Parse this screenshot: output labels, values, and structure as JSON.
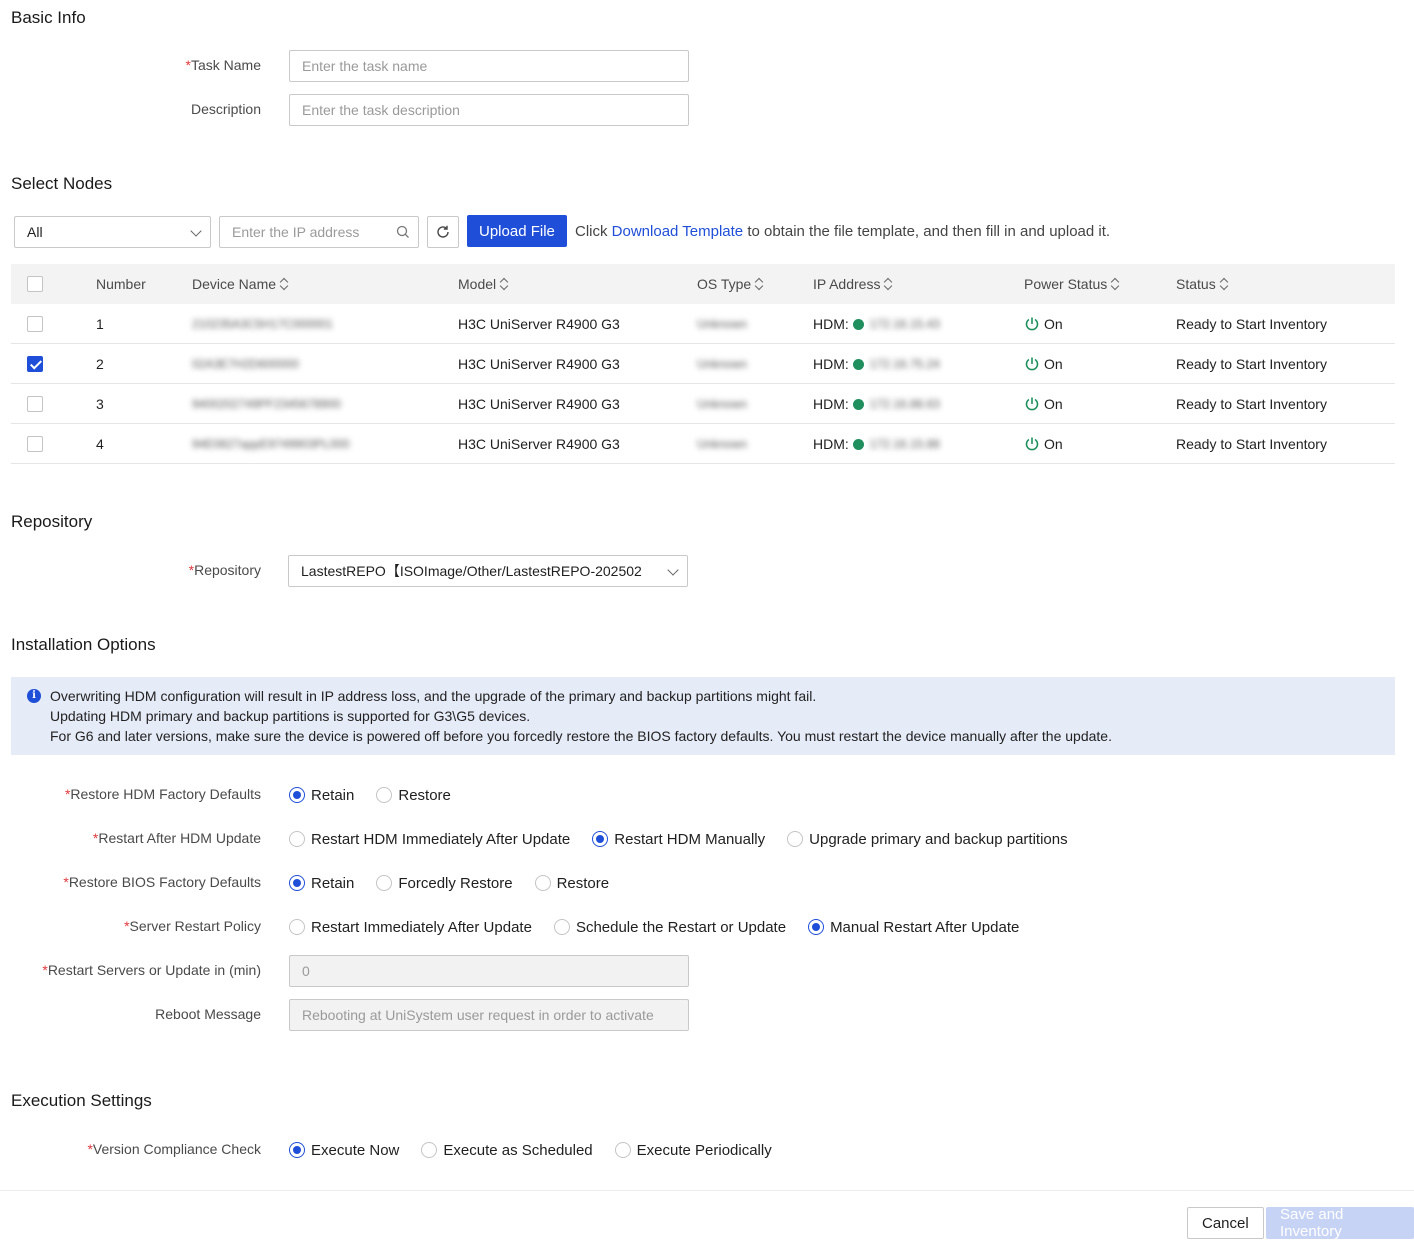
{
  "basic_info": {
    "title": "Basic Info",
    "task_name_label": "Task Name",
    "task_name_placeholder": "Enter the task name",
    "description_label": "Description",
    "description_placeholder": "Enter the task description"
  },
  "select_nodes": {
    "title": "Select Nodes",
    "filter_value": "All",
    "ip_placeholder": "Enter the IP address",
    "upload_label": "Upload File",
    "hint_prefix": "Click ",
    "hint_link": "Download Template",
    "hint_suffix": " to obtain the file template, and then fill in and upload it.",
    "columns": [
      "Number",
      "Device Name",
      "Model",
      "OS Type",
      "IP Address",
      "Power Status",
      "Status"
    ],
    "rows": [
      {
        "checked": false,
        "number": "1",
        "device": "210235A3C5H17C000001",
        "model": "H3C UniServer R4900 G3",
        "os": "Unknown",
        "ip_prefix": "HDM:",
        "ip": "172.16.15.43",
        "power": "On",
        "status": "Ready to Start Inventory"
      },
      {
        "checked": true,
        "number": "2",
        "device": "02A3E7H2D600000",
        "model": "H3C UniServer R4900 G3",
        "os": "Unknown",
        "ip_prefix": "HDM:",
        "ip": "172.16.75.24",
        "power": "On",
        "status": "Ready to Start Inventory"
      },
      {
        "checked": false,
        "number": "3",
        "device": "9400202749PF2345678900",
        "model": "H3C UniServer R4900 G3",
        "os": "Unknown",
        "ip_prefix": "HDM:",
        "ip": "172.16.88.63",
        "power": "On",
        "status": "Ready to Start Inventory"
      },
      {
        "checked": false,
        "number": "4",
        "device": "94E0827appE9749903PL000",
        "model": "H3C UniServer R4900 G3",
        "os": "Unknown",
        "ip_prefix": "HDM:",
        "ip": "172.16.15.88",
        "power": "On",
        "status": "Ready to Start Inventory"
      }
    ]
  },
  "repository": {
    "title": "Repository",
    "label": "Repository",
    "value": "LastestREPO【ISOImage/Other/LastestREPO-202502"
  },
  "installation": {
    "title": "Installation Options",
    "info_lines": [
      "Overwriting HDM configuration will result in IP address loss, and the upgrade of the primary and backup partitions might fail.",
      "Updating HDM primary and backup partitions is supported for G3\\G5 devices.",
      "For G6 and later versions, make sure the device is powered off before you forcedly restore the BIOS factory defaults. You must restart the device manually after the update."
    ],
    "restore_hdm": {
      "label": "Restore HDM Factory Defaults",
      "options": [
        "Retain",
        "Restore"
      ],
      "selected": 0
    },
    "restart_after_hdm": {
      "label": "Restart After HDM Update",
      "options": [
        "Restart HDM Immediately After Update",
        "Restart HDM Manually",
        "Upgrade primary and backup partitions"
      ],
      "selected": 1
    },
    "restore_bios": {
      "label": "Restore BIOS Factory Defaults",
      "options": [
        "Retain",
        "Forcedly Restore",
        "Restore"
      ],
      "selected": 0
    },
    "restart_policy": {
      "label": "Server Restart Policy",
      "options": [
        "Restart Immediately After Update",
        "Schedule the Restart or Update",
        "Manual Restart After Update"
      ],
      "selected": 2
    },
    "restart_min_label": "Restart Servers or Update in (min)",
    "restart_min_value": "0",
    "reboot_label": "Reboot Message",
    "reboot_value": "Rebooting at UniSystem user request in order to activate"
  },
  "execution": {
    "title": "Execution Settings",
    "compliance": {
      "label": "Version Compliance Check",
      "options": [
        "Execute Now",
        "Execute as Scheduled",
        "Execute Periodically"
      ],
      "selected": 0
    }
  },
  "footer": {
    "cancel": "Cancel",
    "save": "Save and Inventory"
  }
}
